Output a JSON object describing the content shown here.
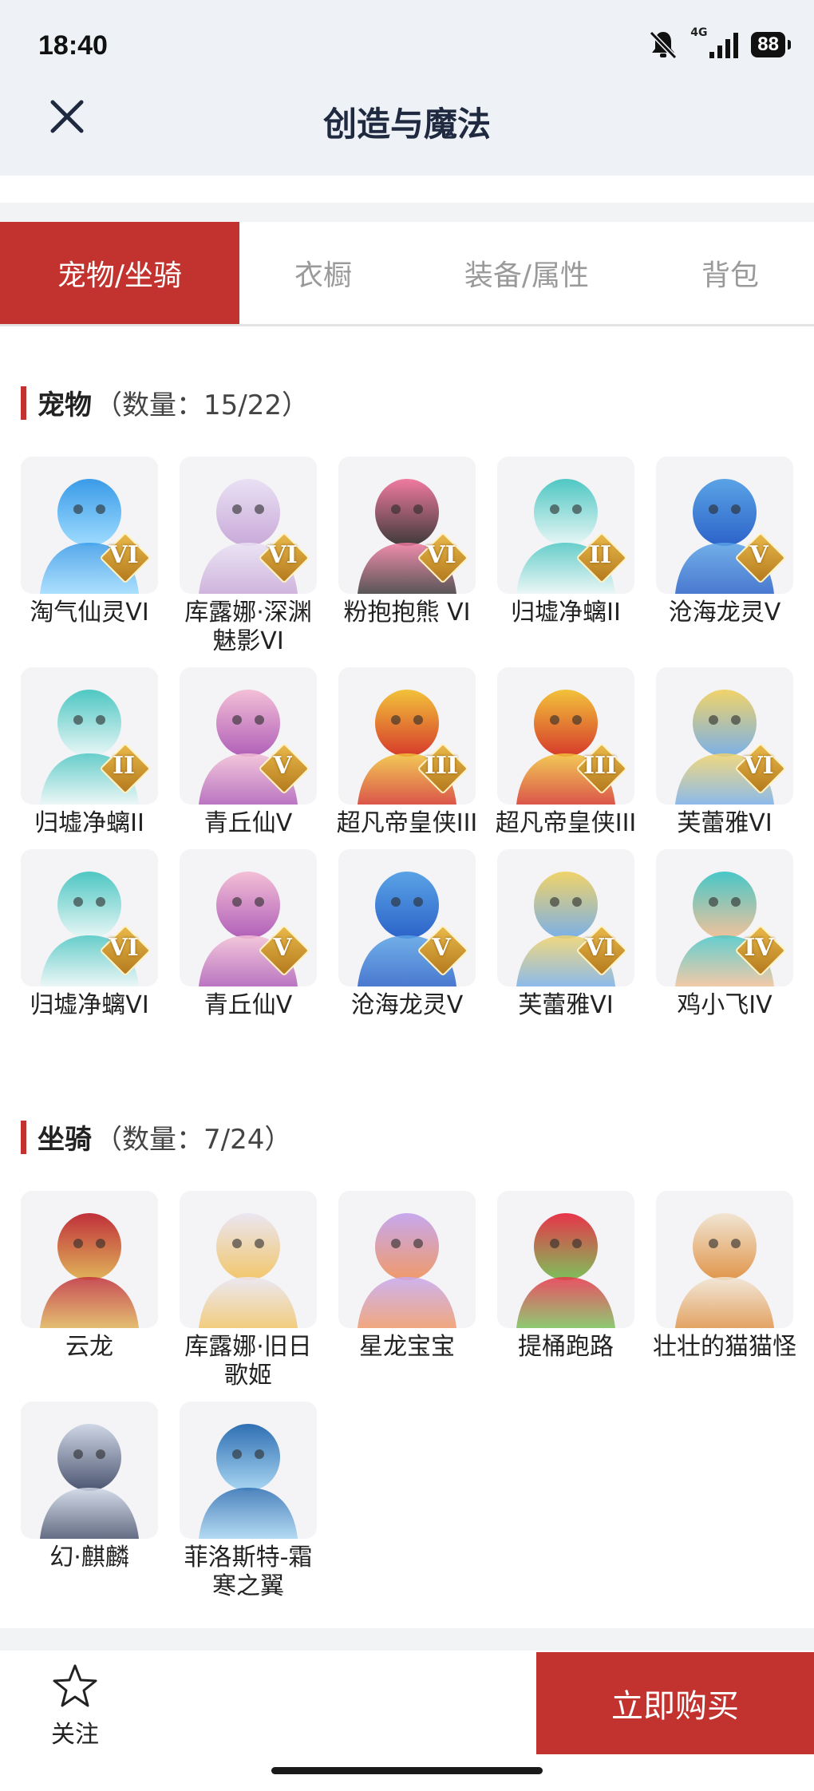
{
  "status_bar": {
    "time": "18:40",
    "network": "4G",
    "battery": "88"
  },
  "header": {
    "title": "创造与魔法"
  },
  "tabs": [
    {
      "label": "宠物/坐骑",
      "active": true
    },
    {
      "label": "衣橱",
      "active": false
    },
    {
      "label": "装备/属性",
      "active": false
    },
    {
      "label": "背包",
      "active": false
    }
  ],
  "pets": {
    "title": "宠物",
    "count": "（数量：15/22）",
    "items": [
      {
        "name": "淘气仙灵VI",
        "grade": "VI",
        "colors": [
          "#3a9be8",
          "#9fdcff"
        ]
      },
      {
        "name": "库露娜·深渊魅影VI",
        "grade": "VI",
        "colors": [
          "#e9e1f4",
          "#c9a9d8"
        ]
      },
      {
        "name": "粉抱抱熊 VI",
        "grade": "VI",
        "colors": [
          "#f07aa0",
          "#3d3a3a"
        ]
      },
      {
        "name": "归墟净螭II",
        "grade": "II",
        "colors": [
          "#4fc7c3",
          "#e9f7f6"
        ]
      },
      {
        "name": "沧海龙灵V",
        "grade": "V",
        "colors": [
          "#5aa3e6",
          "#2c63c9"
        ]
      },
      {
        "name": "归墟净螭II",
        "grade": "II",
        "colors": [
          "#4fc7c3",
          "#e9f7f6"
        ]
      },
      {
        "name": "青丘仙V",
        "grade": "V",
        "colors": [
          "#f3bfd6",
          "#b05fb8"
        ]
      },
      {
        "name": "超凡帝皇侠III",
        "grade": "III",
        "colors": [
          "#f2c23a",
          "#d63a2b"
        ]
      },
      {
        "name": "超凡帝皇侠III",
        "grade": "III",
        "colors": [
          "#f2c23a",
          "#d63a2b"
        ]
      },
      {
        "name": "芙蕾雅VI",
        "grade": "VI",
        "colors": [
          "#f0d36a",
          "#7ab0e8"
        ]
      },
      {
        "name": "归墟净螭VI",
        "grade": "VI",
        "colors": [
          "#4fc7c3",
          "#e9f7f6"
        ]
      },
      {
        "name": "青丘仙V",
        "grade": "V",
        "colors": [
          "#f3bfd6",
          "#b05fb8"
        ]
      },
      {
        "name": "沧海龙灵V",
        "grade": "V",
        "colors": [
          "#5aa3e6",
          "#2c63c9"
        ]
      },
      {
        "name": "芙蕾雅VI",
        "grade": "VI",
        "colors": [
          "#f0d36a",
          "#7ab0e8"
        ]
      },
      {
        "name": "鸡小飞IV",
        "grade": "IV",
        "colors": [
          "#49c7c8",
          "#f2c29a"
        ]
      }
    ]
  },
  "mounts": {
    "title": "坐骑",
    "count": "（数量：7/24）",
    "items": [
      {
        "name": "云龙",
        "colors": [
          "#c0303a",
          "#e0b45a"
        ]
      },
      {
        "name": "库露娜·旧日歌姬",
        "colors": [
          "#eae6f2",
          "#f2c66a"
        ]
      },
      {
        "name": "星龙宝宝",
        "colors": [
          "#c7a8ee",
          "#f09a6a"
        ]
      },
      {
        "name": "提桶跑路",
        "colors": [
          "#e8344a",
          "#7cc25a"
        ]
      },
      {
        "name": "壮壮的猫猫怪",
        "colors": [
          "#f1e5d3",
          "#e0954a"
        ]
      },
      {
        "name": "幻·麒麟",
        "colors": [
          "#cfd7e6",
          "#4b5570"
        ]
      },
      {
        "name": "菲洛斯特-霜寒之翼",
        "colors": [
          "#2f6fb3",
          "#a9d6f2"
        ]
      }
    ]
  },
  "footer": {
    "favorite_label": "关注",
    "buy_label": "立即购买"
  },
  "theme": {
    "accent": "#c2332f"
  }
}
